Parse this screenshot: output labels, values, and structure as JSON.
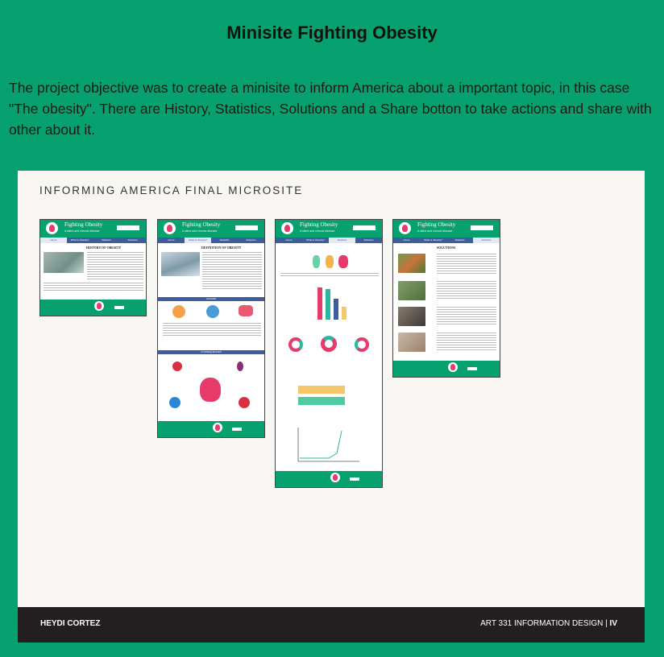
{
  "title": "Minisite Fighting Obesity",
  "description": "The project objective was to create a minisite to inform America about a important topic, in this case \"The obesity\". There are History, Statistics, Solutions and a Share botton to take actions and share with other about it.",
  "board": {
    "heading": "INFORMING AMERICA FINAL MICROSITE",
    "author": "HEYDI CORTEZ",
    "course": "ART 331 INFORMATION DESIGN |",
    "course_num": "IV"
  },
  "site": {
    "title": "Fighting Obesity",
    "subtitle": "A silent and chronic disease",
    "nav": [
      "Home",
      "What is Obesity?",
      "Statistics",
      "Solutions"
    ]
  },
  "pages": {
    "history_heading": "HISTORY OF OBESITY",
    "definition_heading": "DEFINITION OF OBESITY",
    "causes_heading": "CAUSES",
    "consequences_heading": "CONSEQUENCES",
    "solutions_heading": "SOLUTIONS"
  },
  "colors": {
    "background": "#07a06f",
    "board": "#f7f6f3",
    "footer": "#231f20",
    "site_green": "#07a06f",
    "site_nav": "#3d5d9e",
    "accent_pink": "#e63a6a"
  }
}
